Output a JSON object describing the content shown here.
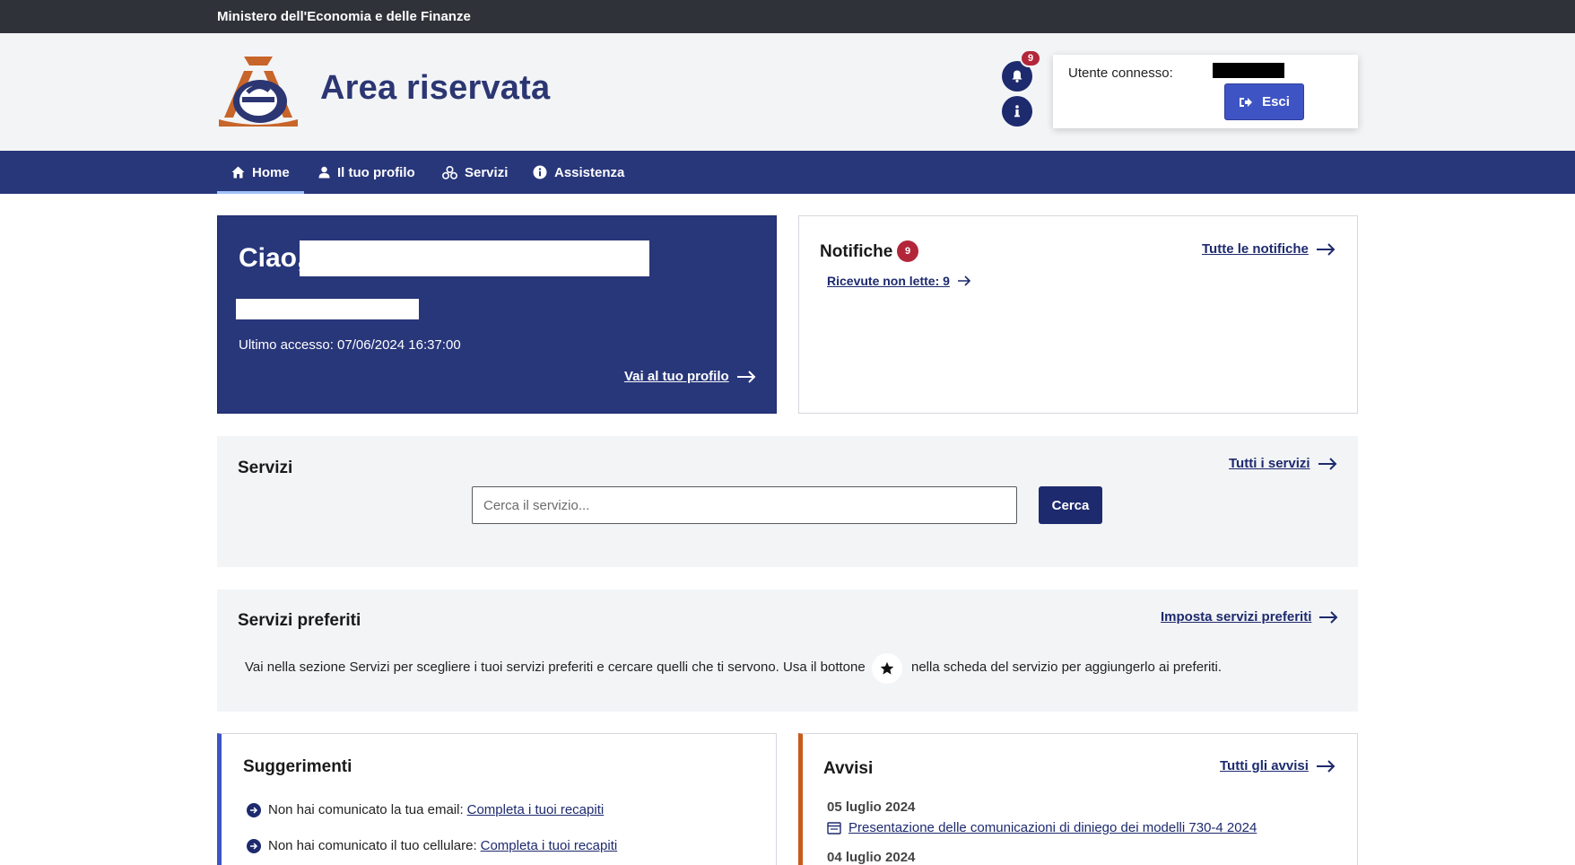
{
  "topbar": {
    "ministry": "Ministero dell'Economia e delle Finanze"
  },
  "header": {
    "title": "Area riservata",
    "notification_count": "9",
    "user_label": "Utente connesso:",
    "logout_label": "Esci"
  },
  "nav": {
    "items": [
      {
        "label": "Home",
        "icon": "home-icon",
        "active": true
      },
      {
        "label": "Il tuo profilo",
        "icon": "user-icon",
        "active": false
      },
      {
        "label": "Servizi",
        "icon": "services-icon",
        "active": false
      },
      {
        "label": "Assistenza",
        "icon": "info-icon",
        "active": false
      }
    ]
  },
  "welcome": {
    "greeting": "Ciao,",
    "last_access": "Ultimo accesso: 07/06/2024 16:37:00",
    "profile_link": "Vai al tuo profilo"
  },
  "notifications": {
    "title": "Notifiche",
    "count": "9",
    "all_link": "Tutte le notifiche",
    "unread_link": "Ricevute non lette: 9"
  },
  "services": {
    "title": "Servizi",
    "all_link": "Tutti i servizi",
    "search_placeholder": "Cerca il servizio...",
    "search_button": "Cerca"
  },
  "favorites": {
    "title": "Servizi preferiti",
    "set_link": "Imposta servizi preferiti",
    "text_before": "Vai nella sezione Servizi per scegliere i tuoi servizi preferiti e cercare quelli che ti servono. Usa il bottone",
    "text_after": "nella scheda del servizio per aggiungerlo ai preferiti."
  },
  "suggestions": {
    "title": "Suggerimenti",
    "items": [
      {
        "text": "Non hai comunicato la tua email:",
        "link": "Completa i tuoi recapiti"
      },
      {
        "text": "Non hai comunicato il tuo cellulare:",
        "link": "Completa i tuoi recapiti"
      }
    ]
  },
  "notices": {
    "title": "Avvisi",
    "all_link": "Tutti gli avvisi",
    "items": [
      {
        "date": "05 luglio 2024",
        "link": "Presentazione delle comunicazioni di diniego dei modelli 730-4 2024"
      },
      {
        "date": "04 luglio 2024"
      }
    ]
  },
  "colors": {
    "primary": "#28367a",
    "accent_blue": "#3f54c4",
    "accent_orange": "#c85a1a",
    "badge_red": "#b3263a"
  }
}
